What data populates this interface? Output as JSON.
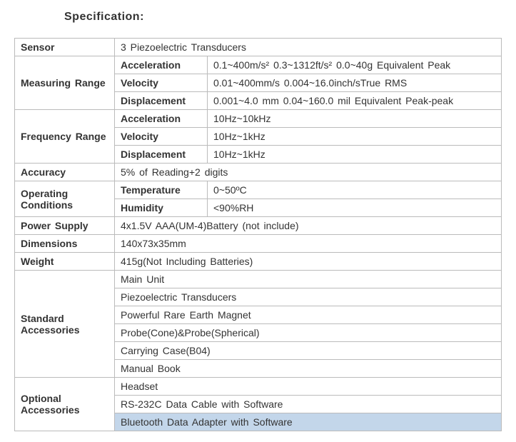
{
  "title": "Specification:",
  "rows": {
    "sensor_label": "Sensor",
    "sensor_value": "3 Piezoelectric Transducers",
    "measuring_range_label": "Measuring Range",
    "mr_accel_label": "Acceleration",
    "mr_accel_value": "0.1~400m/s² 0.3~1312ft/s² 0.0~40g Equivalent Peak",
    "mr_vel_label": "Velocity",
    "mr_vel_value": "0.01~400mm/s 0.004~16.0inch/sTrue RMS",
    "mr_disp_label": "Displacement",
    "mr_disp_value": "0.001~4.0 mm 0.04~160.0 mil Equivalent Peak-peak",
    "freq_range_label": "Frequency Range",
    "fr_accel_label": "Acceleration",
    "fr_accel_value": "10Hz~10kHz",
    "fr_vel_label": "Velocity",
    "fr_vel_value": "10Hz~1kHz",
    "fr_disp_label": "Displacement",
    "fr_disp_value": "10Hz~1kHz",
    "accuracy_label": "Accuracy",
    "accuracy_value": "5% of Reading+2 digits",
    "operating_label": "Operating Conditions",
    "op_temp_label": "Temperature",
    "op_temp_value": "0~50ºC",
    "op_hum_label": "Humidity",
    "op_hum_value": "<90%RH",
    "power_label": "Power Supply",
    "power_value": "4x1.5V AAA(UM-4)Battery   (not include)",
    "dimensions_label": "Dimensions",
    "dimensions_value": "140x73x35mm",
    "weight_label": "Weight",
    "weight_value": "415g(Not Including Batteries)",
    "std_acc_label": "Standard Accessories",
    "std_acc_1": "Main Unit",
    "std_acc_2": "Piezoelectric Transducers",
    "std_acc_3": "Powerful Rare Earth Magnet",
    "std_acc_4": "Probe(Cone)&Probe(Spherical)",
    "std_acc_5": "Carrying Case(B04)",
    "std_acc_6": "Manual Book",
    "opt_acc_label": "Optional Accessories",
    "opt_acc_1": "Headset",
    "opt_acc_2": "RS-232C Data Cable with Software",
    "opt_acc_3": "Bluetooth Data Adapter with Software"
  }
}
